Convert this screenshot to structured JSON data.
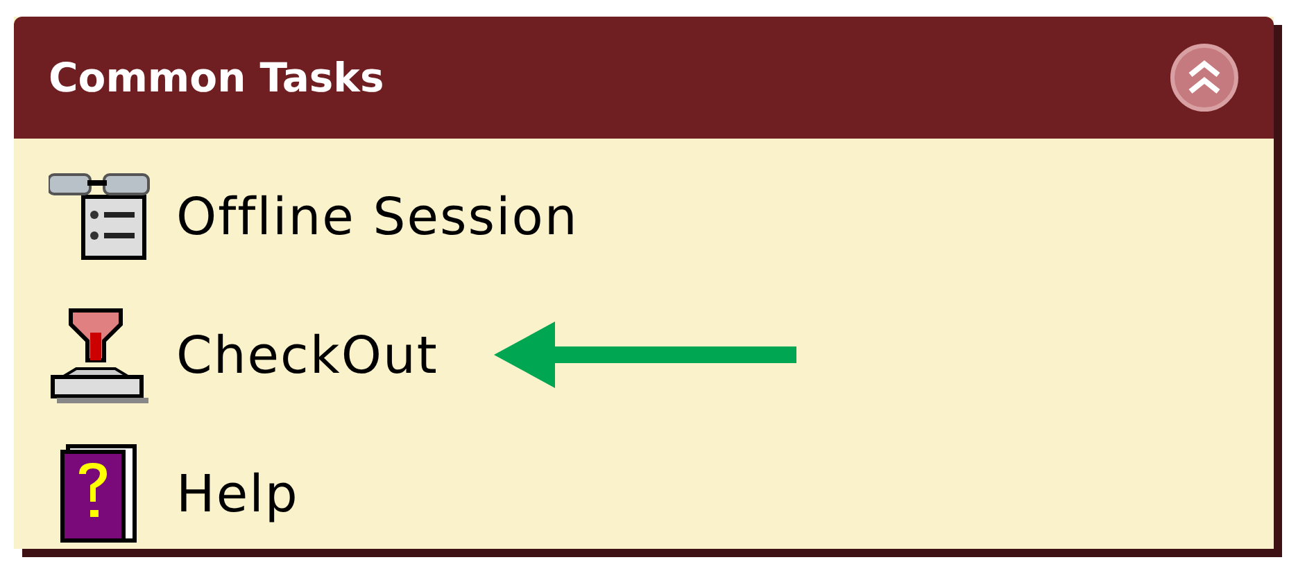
{
  "panel": {
    "title": "Common Tasks",
    "collapsed": false,
    "items": [
      {
        "kind": "offline",
        "label": "Offline Session",
        "pointed": false
      },
      {
        "kind": "checkout",
        "label": "CheckOut",
        "pointed": true
      },
      {
        "kind": "help",
        "label": "Help",
        "pointed": false
      }
    ]
  }
}
